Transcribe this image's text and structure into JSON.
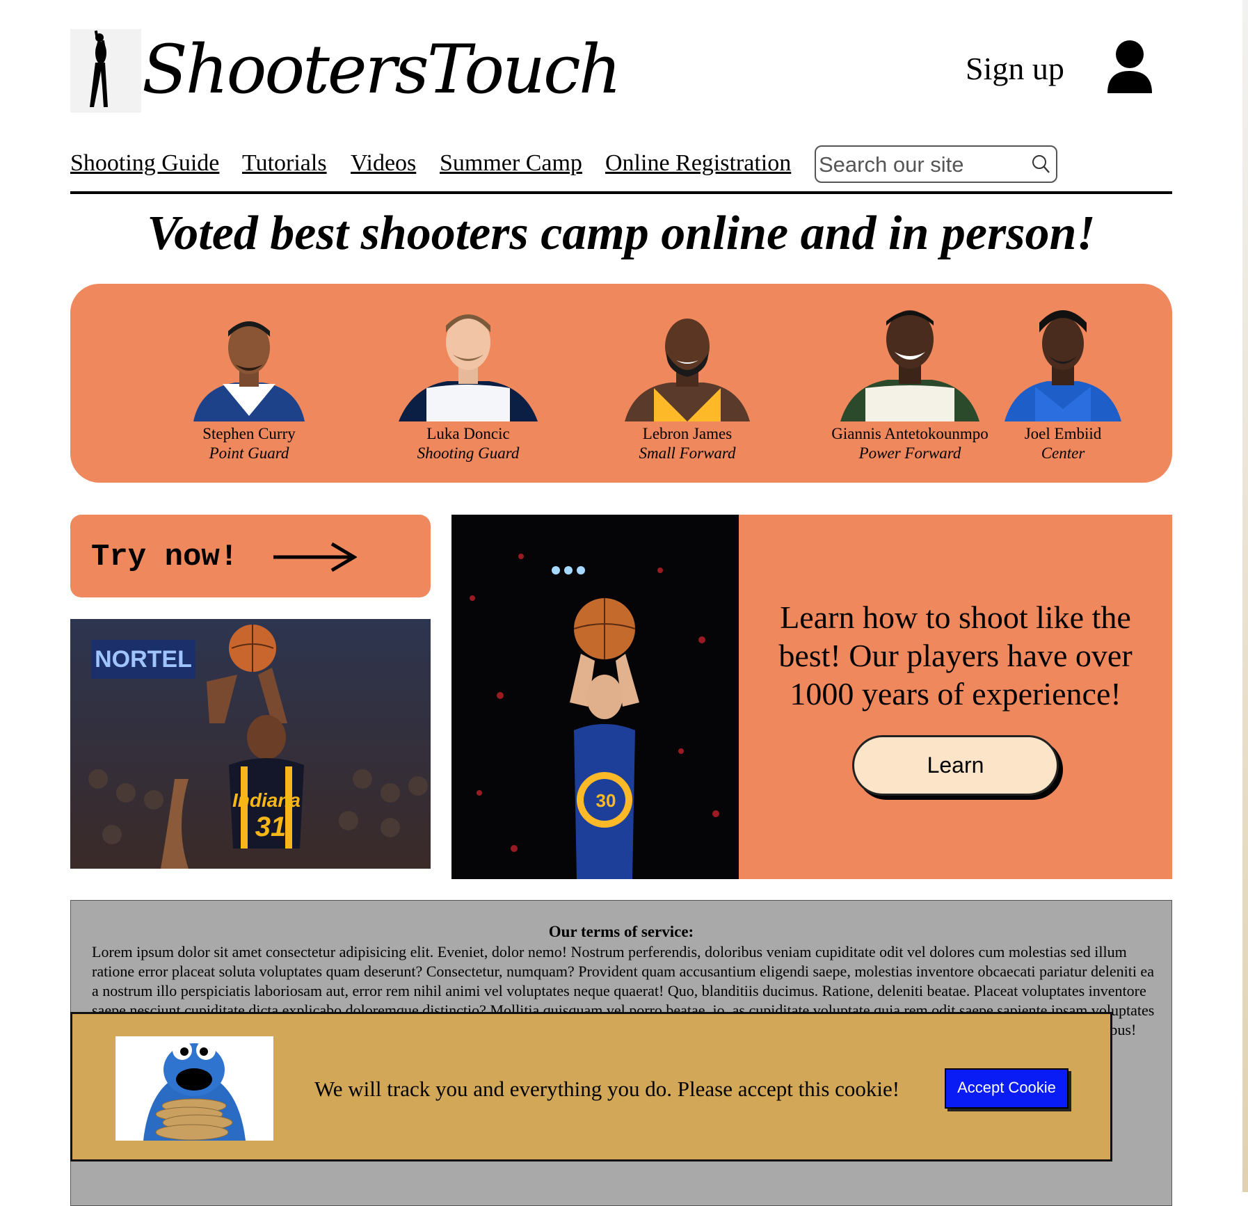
{
  "header": {
    "brand": "ShootersTouch",
    "signup_label": "Sign up"
  },
  "nav": {
    "links": [
      "Shooting Guide",
      "Tutorials",
      "Videos",
      "Summer Camp",
      "Online Registration"
    ],
    "search_placeholder": "Search our site"
  },
  "hero": {
    "headline": "Voted best shooters camp online and in person!"
  },
  "players": [
    {
      "name": "Stephen Curry",
      "position": "Point Guard"
    },
    {
      "name": "Luka Doncic",
      "position": "Shooting Guard"
    },
    {
      "name": "Lebron James",
      "position": "Small Forward"
    },
    {
      "name": "Giannis Antetokounmpo",
      "position": "Power Forward"
    },
    {
      "name": "Joel Embiid",
      "position": "Center"
    }
  ],
  "try_now": {
    "label": "Try now!"
  },
  "promo": {
    "text": "Learn how to shoot like the best! Our players have over 1000 years of experience!",
    "button_label": "Learn"
  },
  "photo_left": {
    "banner_text": "NORTEL",
    "jersey_text": "Indiana",
    "jersey_number": "31"
  },
  "photo_mid": {
    "jersey_number": "30"
  },
  "terms": {
    "title": "Our terms of service:",
    "body": "Lorem ipsum dolor sit amet consectetur adipisicing elit. Eveniet, dolor nemo! Nostrum perferendis, doloribus veniam cupiditate odit vel dolores cum molestias sed illum ratione error placeat soluta voluptates quam deserunt? Consectetur, numquam? Provident quam accusantium eligendi saepe, molestias inventore obcaecati pariatur deleniti ea a nostrum illo perspiciatis laboriosam aut, error rem nihil animi vel voluptates neque quaerat! Quo, blanditiis ducimus. Ratione, deleniti beatae. Placeat voluptates inventore saepe nesciunt cupiditate dicta explicabo doloremque distinctio? Mollitia quisquam vel porro beatae, io, as cupiditate voluptate quia rem odit saepe sapiente ipsam voluptates voluptas quidem! Eveniet officia tempore similique accusantium, architecto dolor qui, dolores voluptate impedit culpa in, voluptas sapiente animi aspernatur voluptatibus! Ipsa incidunt libero nesciunt explicabo labore dolorum sint odio, modi"
  },
  "cookie": {
    "message": "We will track you and everything you do. Please accept this cookie!",
    "button_label": "Accept Cookie"
  },
  "colors": {
    "accent": "#f0885d",
    "cookie_bg": "#d2a858",
    "cookie_button": "#0a1cf5",
    "learn_button": "#fbe4c8",
    "terms_bg": "#a9a9a9"
  }
}
